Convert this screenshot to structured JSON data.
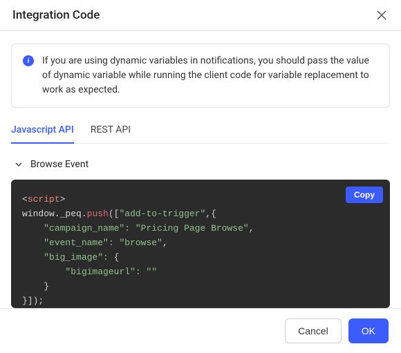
{
  "header": {
    "title": "Integration Code"
  },
  "info": {
    "text": "If you are using dynamic variables in notifications, you should pass the value of dynamic variable while running the client code for variable replacement to work as expected."
  },
  "tabs": {
    "items": [
      {
        "label": "Javascript API"
      },
      {
        "label": "REST API"
      }
    ],
    "active": 0
  },
  "section": {
    "title": "Browse Event",
    "copy_label": "Copy"
  },
  "code": {
    "tokens": {
      "lt": "<",
      "gt": ">",
      "script_tag": "script",
      "window_peq": "window._peq",
      "dot": ".",
      "push": "push",
      "open_call": "([",
      "str_add_to_trigger": "\"add-to-trigger\"",
      "comma_brace": ",{",
      "key_campaign": "\"campaign_name\":",
      "val_campaign": "\"Pricing Page Browse\"",
      "comma": ",",
      "key_event": "\"event_name\":",
      "val_event": "\"browse\"",
      "key_bigimage": "\"big_image\":",
      "open_brace": "{",
      "key_bigurl": "\"bigimageurl\":",
      "val_empty": "\"\"",
      "close_brace": "}",
      "close_call": "}]);"
    }
  },
  "footer": {
    "cancel": "Cancel",
    "ok": "OK"
  }
}
